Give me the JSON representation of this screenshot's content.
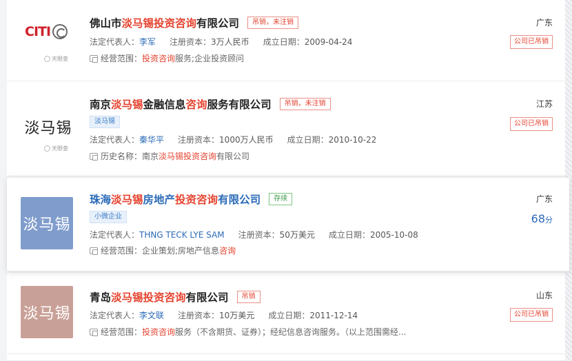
{
  "companies": [
    {
      "name_parts": [
        "佛山市",
        "淡马锡投资咨询",
        "有限公司"
      ],
      "status_tag": "吊销，未注销",
      "legal_rep_label": "法定代表人：",
      "legal_rep": "李军",
      "capital_label": "注册资本：",
      "capital": "3万人民币",
      "date_label": "成立日期：",
      "date": "2009-04-24",
      "scope_label": "经营范围：",
      "scope_parts": [
        "投资咨询",
        "服务;企业投资顾问"
      ],
      "region": "广东",
      "badge": "公司已吊销",
      "logo_text": "CITI",
      "watermark": "天眼查"
    },
    {
      "name_parts": [
        "南京",
        "淡马锡",
        "金融信息",
        "咨询",
        "服务有限公司"
      ],
      "status_tag": "吊销，未注销",
      "sub_tag": "淡马锡",
      "legal_rep_label": "法定代表人：",
      "legal_rep": "秦华平",
      "capital_label": "注册资本：",
      "capital": "1000万人民币",
      "date_label": "成立日期：",
      "date": "2010-10-22",
      "scope_label": "历史名称：",
      "scope_parts": [
        "南京",
        "淡马锡投资咨询",
        "有限公司"
      ],
      "region": "江苏",
      "badge": "公司已吊销",
      "logo_text": "淡马锡",
      "watermark": "天眼查"
    },
    {
      "name_parts": [
        "珠海",
        "淡马锡",
        "房地产",
        "投资咨询",
        "有限公司"
      ],
      "status_tag": "存续",
      "sub_tag": "小微企业",
      "legal_rep_label": "法定代表人：",
      "legal_rep": "THNG TECK LYE SAM",
      "capital_label": "注册资本：",
      "capital": "50万美元",
      "date_label": "成立日期：",
      "date": "2005-10-08",
      "scope_label": "经营范围：",
      "scope_parts": [
        "企业策划;房地产信息",
        "咨询"
      ],
      "region": "广东",
      "score": "68",
      "score_unit": "分",
      "logo_text": "淡马锡",
      "logo_color": "#7f9ccc"
    },
    {
      "name_parts": [
        "青岛",
        "淡马锡投资咨询",
        "有限公司"
      ],
      "status_tag": "吊销",
      "legal_rep_label": "法定代表人：",
      "legal_rep": "李文联",
      "capital_label": "注册资本：",
      "capital": "10万美元",
      "date_label": "成立日期：",
      "date": "2011-12-14",
      "scope_label": "经营范围：",
      "scope_parts": [
        "投资咨询",
        "服务（不含期货、证券）；经纪信息咨询服务。（以上范围需经..."
      ],
      "region": "山东",
      "badge": "公司已吊销",
      "logo_text": "淡马锡",
      "logo_color": "#c9a097"
    }
  ],
  "colors": {
    "highlight": "#e5432f",
    "link": "#2a6ab7"
  }
}
